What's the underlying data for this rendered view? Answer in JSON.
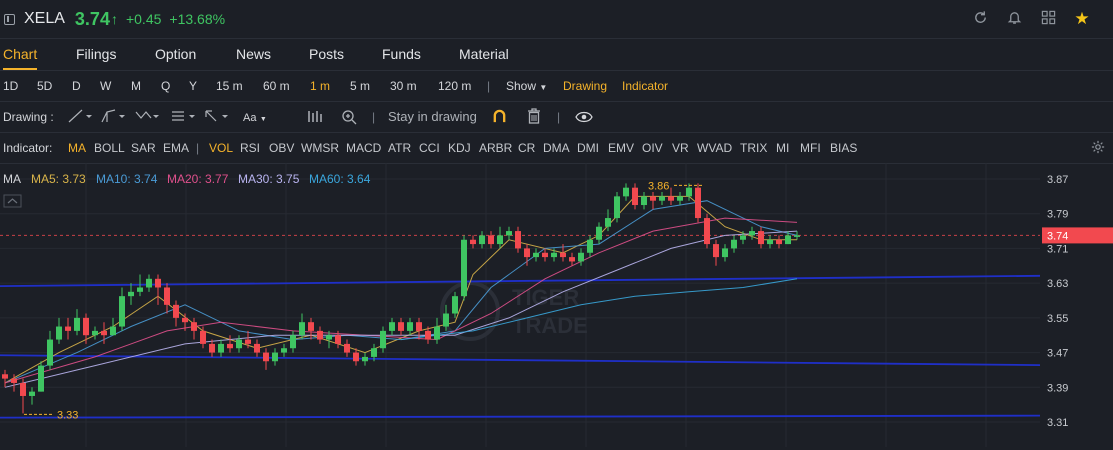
{
  "header": {
    "symbol": "XELA",
    "price": "3.74",
    "arrow": "↑",
    "change": "+0.45",
    "change_pct": "+13.68%"
  },
  "tabs": [
    {
      "label": "Chart",
      "active": true
    },
    {
      "label": "Filings"
    },
    {
      "label": "Option"
    },
    {
      "label": "News"
    },
    {
      "label": "Posts"
    },
    {
      "label": "Funds"
    },
    {
      "label": "Material"
    }
  ],
  "periods": [
    "1D",
    "5D",
    "D",
    "W",
    "M",
    "Q",
    "Y",
    "15 m",
    "60 m",
    "1 m",
    "5 m",
    "30 m",
    "120 m"
  ],
  "active_period": "1 m",
  "period_menu": {
    "show": "Show",
    "drawing": "Drawing",
    "indicator": "Indicator"
  },
  "drawing_bar": {
    "label": "Drawing :",
    "stay": "Stay in drawing",
    "text_tool": "Aa"
  },
  "indicator_bar": {
    "label": "Indicator:",
    "items": [
      "MA",
      "BOLL",
      "SAR",
      "EMA",
      "VOL",
      "RSI",
      "OBV",
      "WMSR",
      "MACD",
      "ATR",
      "CCI",
      "KDJ",
      "ARBR",
      "CR",
      "DMA",
      "DMI",
      "EMV",
      "OIV",
      "VR",
      "WVAD",
      "TRIX",
      "MI",
      "MFI",
      "BIAS"
    ],
    "active": [
      "MA",
      "VOL"
    ]
  },
  "ma_legend": {
    "title": "MA",
    "items": [
      {
        "label": "MA5: 3.73",
        "color": "#d9b44a"
      },
      {
        "label": "MA10: 3.74",
        "color": "#4a9bd6"
      },
      {
        "label": "MA20: 3.77",
        "color": "#e0508c"
      },
      {
        "label": "MA30: 3.75",
        "color": "#b9b4f0"
      },
      {
        "label": "MA60: 3.64",
        "color": "#3aa6dc"
      }
    ]
  },
  "colors": {
    "up": "#3fc562",
    "down": "#f2494f",
    "accent": "#f5b32b",
    "blue_line": "#1f2fc8"
  },
  "chart_data": {
    "type": "candlestick",
    "y_ticks": [
      "3.87",
      "3.79",
      "3.71",
      "3.63",
      "3.55",
      "3.47",
      "3.39",
      "3.31"
    ],
    "ylim": [
      3.3,
      3.89
    ],
    "current_price_label": "3.74",
    "current_price": 3.74,
    "high_annotation": {
      "label": "3.86",
      "value": 3.86
    },
    "low_annotation": {
      "label": "3.33",
      "value": 3.33
    },
    "watermark": [
      "TIGER",
      "TRADE"
    ],
    "horizontal_lines": [
      3.637,
      3.64,
      3.457,
      3.448,
      3.32
    ],
    "candles": [
      [
        3.42,
        3.41,
        3.43,
        3.39
      ],
      [
        3.41,
        3.4,
        3.42,
        3.38
      ],
      [
        3.4,
        3.37,
        3.41,
        3.33
      ],
      [
        3.37,
        3.38,
        3.39,
        3.35
      ],
      [
        3.38,
        3.44,
        3.45,
        3.38
      ],
      [
        3.44,
        3.5,
        3.52,
        3.43
      ],
      [
        3.5,
        3.53,
        3.55,
        3.49
      ],
      [
        3.53,
        3.52,
        3.55,
        3.5
      ],
      [
        3.52,
        3.55,
        3.57,
        3.51
      ],
      [
        3.55,
        3.51,
        3.56,
        3.49
      ],
      [
        3.51,
        3.52,
        3.53,
        3.5
      ],
      [
        3.52,
        3.51,
        3.54,
        3.49
      ],
      [
        3.51,
        3.53,
        3.55,
        3.51
      ],
      [
        3.53,
        3.6,
        3.62,
        3.52
      ],
      [
        3.6,
        3.61,
        3.63,
        3.58
      ],
      [
        3.61,
        3.62,
        3.65,
        3.6
      ],
      [
        3.62,
        3.64,
        3.65,
        3.61
      ],
      [
        3.64,
        3.62,
        3.65,
        3.58
      ],
      [
        3.62,
        3.58,
        3.63,
        3.56
      ],
      [
        3.58,
        3.55,
        3.59,
        3.53
      ],
      [
        3.55,
        3.54,
        3.56,
        3.52
      ],
      [
        3.54,
        3.52,
        3.55,
        3.5
      ],
      [
        3.52,
        3.49,
        3.53,
        3.48
      ],
      [
        3.49,
        3.47,
        3.5,
        3.46
      ],
      [
        3.47,
        3.49,
        3.5,
        3.46
      ],
      [
        3.49,
        3.48,
        3.51,
        3.47
      ],
      [
        3.48,
        3.5,
        3.51,
        3.47
      ],
      [
        3.5,
        3.49,
        3.52,
        3.48
      ],
      [
        3.49,
        3.47,
        3.5,
        3.46
      ],
      [
        3.47,
        3.45,
        3.48,
        3.43
      ],
      [
        3.45,
        3.47,
        3.48,
        3.44
      ],
      [
        3.47,
        3.48,
        3.49,
        3.46
      ],
      [
        3.48,
        3.51,
        3.52,
        3.47
      ],
      [
        3.51,
        3.54,
        3.56,
        3.5
      ],
      [
        3.54,
        3.52,
        3.55,
        3.5
      ],
      [
        3.52,
        3.5,
        3.53,
        3.49
      ],
      [
        3.5,
        3.51,
        3.52,
        3.48
      ],
      [
        3.51,
        3.49,
        3.52,
        3.48
      ],
      [
        3.49,
        3.47,
        3.5,
        3.46
      ],
      [
        3.47,
        3.45,
        3.48,
        3.44
      ],
      [
        3.45,
        3.46,
        3.47,
        3.44
      ],
      [
        3.46,
        3.48,
        3.49,
        3.45
      ],
      [
        3.48,
        3.52,
        3.53,
        3.47
      ],
      [
        3.52,
        3.54,
        3.55,
        3.51
      ],
      [
        3.54,
        3.52,
        3.55,
        3.51
      ],
      [
        3.52,
        3.54,
        3.55,
        3.51
      ],
      [
        3.54,
        3.52,
        3.55,
        3.5
      ],
      [
        3.52,
        3.5,
        3.53,
        3.49
      ],
      [
        3.5,
        3.53,
        3.55,
        3.49
      ],
      [
        3.53,
        3.56,
        3.58,
        3.52
      ],
      [
        3.56,
        3.6,
        3.61,
        3.55
      ],
      [
        3.6,
        3.73,
        3.74,
        3.59
      ],
      [
        3.73,
        3.72,
        3.74,
        3.71
      ],
      [
        3.72,
        3.74,
        3.75,
        3.71
      ],
      [
        3.74,
        3.72,
        3.75,
        3.71
      ],
      [
        3.72,
        3.74,
        3.76,
        3.71
      ],
      [
        3.74,
        3.75,
        3.76,
        3.73
      ],
      [
        3.75,
        3.71,
        3.76,
        3.7
      ],
      [
        3.71,
        3.69,
        3.72,
        3.67
      ],
      [
        3.69,
        3.7,
        3.71,
        3.68
      ],
      [
        3.7,
        3.69,
        3.71,
        3.68
      ],
      [
        3.69,
        3.7,
        3.71,
        3.68
      ],
      [
        3.7,
        3.69,
        3.72,
        3.68
      ],
      [
        3.69,
        3.68,
        3.7,
        3.67
      ],
      [
        3.68,
        3.7,
        3.71,
        3.67
      ],
      [
        3.7,
        3.73,
        3.74,
        3.69
      ],
      [
        3.73,
        3.76,
        3.77,
        3.72
      ],
      [
        3.76,
        3.78,
        3.8,
        3.75
      ],
      [
        3.78,
        3.83,
        3.84,
        3.77
      ],
      [
        3.83,
        3.85,
        3.86,
        3.82
      ],
      [
        3.85,
        3.81,
        3.86,
        3.8
      ],
      [
        3.81,
        3.83,
        3.84,
        3.8
      ],
      [
        3.83,
        3.82,
        3.84,
        3.8
      ],
      [
        3.82,
        3.83,
        3.84,
        3.81
      ],
      [
        3.83,
        3.82,
        3.85,
        3.81
      ],
      [
        3.82,
        3.83,
        3.84,
        3.81
      ],
      [
        3.83,
        3.85,
        3.86,
        3.82
      ],
      [
        3.85,
        3.78,
        3.86,
        3.77
      ],
      [
        3.78,
        3.72,
        3.79,
        3.71
      ],
      [
        3.72,
        3.69,
        3.73,
        3.67
      ],
      [
        3.69,
        3.71,
        3.72,
        3.68
      ],
      [
        3.71,
        3.73,
        3.74,
        3.7
      ],
      [
        3.73,
        3.74,
        3.75,
        3.72
      ],
      [
        3.74,
        3.75,
        3.76,
        3.73
      ],
      [
        3.75,
        3.72,
        3.76,
        3.71
      ],
      [
        3.72,
        3.73,
        3.74,
        3.71
      ],
      [
        3.73,
        3.72,
        3.74,
        3.71
      ],
      [
        3.72,
        3.74,
        3.75,
        3.72
      ],
      [
        3.74,
        3.74,
        3.75,
        3.73
      ]
    ],
    "ma_series": [
      {
        "label": "MA5",
        "color": "#d9b44a",
        "points": [
          [
            0,
            3.4
          ],
          [
            6,
            3.47
          ],
          [
            12,
            3.53
          ],
          [
            17,
            3.6
          ],
          [
            22,
            3.52
          ],
          [
            28,
            3.48
          ],
          [
            34,
            3.51
          ],
          [
            40,
            3.47
          ],
          [
            46,
            3.52
          ],
          [
            50,
            3.54
          ],
          [
            52,
            3.65
          ],
          [
            56,
            3.73
          ],
          [
            62,
            3.7
          ],
          [
            66,
            3.74
          ],
          [
            70,
            3.83
          ],
          [
            76,
            3.83
          ],
          [
            80,
            3.76
          ],
          [
            84,
            3.73
          ],
          [
            88,
            3.73
          ]
        ]
      },
      {
        "label": "MA10",
        "color": "#4a9bd6",
        "points": [
          [
            0,
            3.4
          ],
          [
            8,
            3.47
          ],
          [
            14,
            3.53
          ],
          [
            20,
            3.58
          ],
          [
            26,
            3.52
          ],
          [
            32,
            3.5
          ],
          [
            38,
            3.51
          ],
          [
            44,
            3.5
          ],
          [
            50,
            3.52
          ],
          [
            54,
            3.62
          ],
          [
            60,
            3.71
          ],
          [
            66,
            3.72
          ],
          [
            72,
            3.8
          ],
          [
            78,
            3.82
          ],
          [
            84,
            3.76
          ],
          [
            88,
            3.74
          ]
        ]
      },
      {
        "label": "MA20",
        "color": "#e0508c",
        "points": [
          [
            0,
            3.4
          ],
          [
            10,
            3.46
          ],
          [
            18,
            3.52
          ],
          [
            24,
            3.54
          ],
          [
            32,
            3.52
          ],
          [
            40,
            3.51
          ],
          [
            48,
            3.5
          ],
          [
            54,
            3.56
          ],
          [
            60,
            3.64
          ],
          [
            66,
            3.7
          ],
          [
            72,
            3.75
          ],
          [
            80,
            3.78
          ],
          [
            88,
            3.77
          ]
        ]
      },
      {
        "label": "MA30",
        "color": "#b9b4f0",
        "points": [
          [
            0,
            3.39
          ],
          [
            10,
            3.44
          ],
          [
            20,
            3.49
          ],
          [
            30,
            3.51
          ],
          [
            40,
            3.51
          ],
          [
            50,
            3.51
          ],
          [
            56,
            3.55
          ],
          [
            62,
            3.61
          ],
          [
            68,
            3.66
          ],
          [
            74,
            3.71
          ],
          [
            80,
            3.74
          ],
          [
            88,
            3.75
          ]
        ]
      },
      {
        "label": "MA60",
        "color": "#3aa6dc",
        "points": [
          [
            44,
            3.5
          ],
          [
            52,
            3.52
          ],
          [
            58,
            3.55
          ],
          [
            64,
            3.58
          ],
          [
            70,
            3.6
          ],
          [
            76,
            3.61
          ],
          [
            82,
            3.62
          ],
          [
            88,
            3.64
          ]
        ]
      }
    ]
  }
}
